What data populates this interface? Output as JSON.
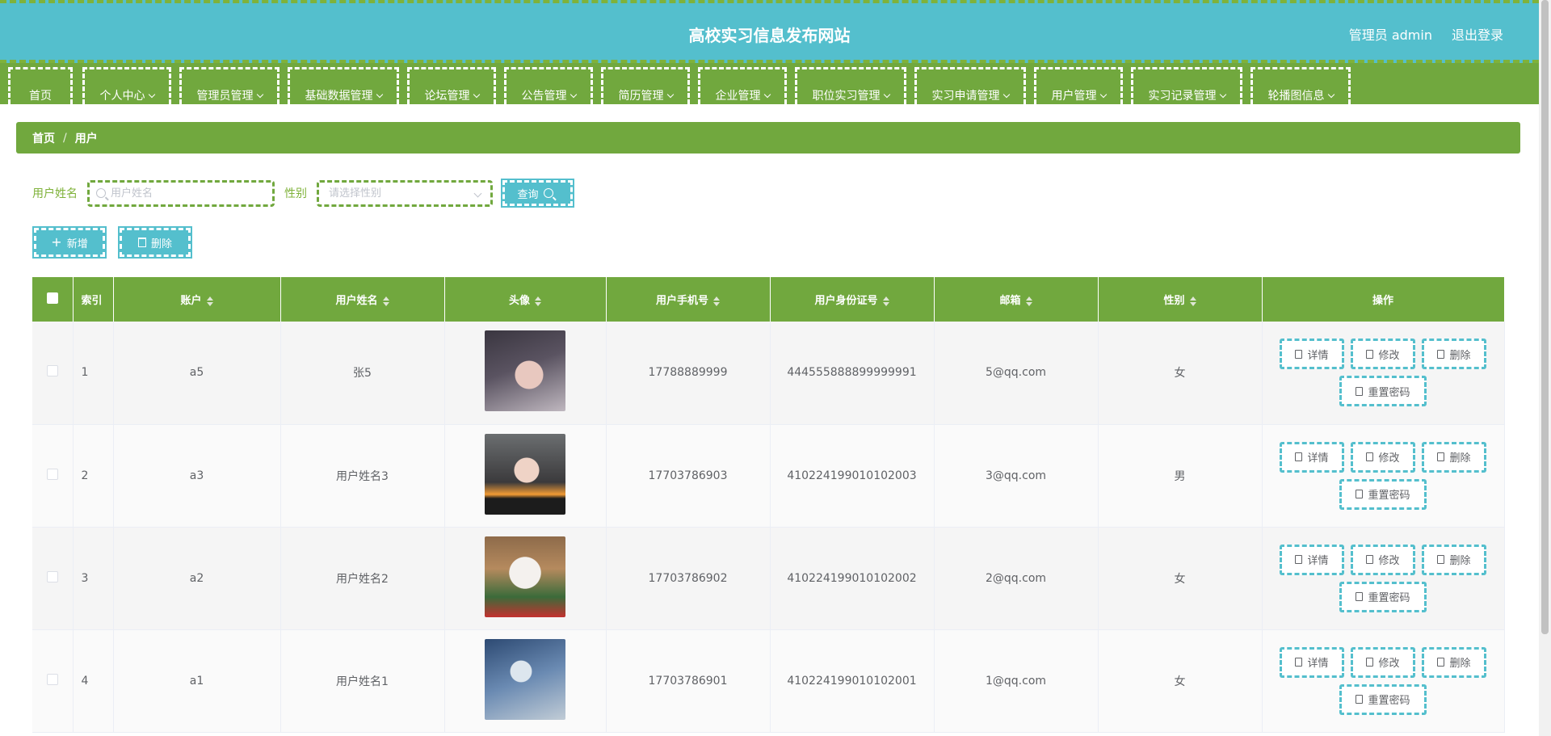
{
  "header": {
    "title": "高校实习信息发布网站",
    "user_label": "管理员 admin",
    "logout_label": "退出登录"
  },
  "nav": {
    "items": [
      {
        "label": "首页",
        "has_dropdown": false
      },
      {
        "label": "个人中心",
        "has_dropdown": true
      },
      {
        "label": "管理员管理",
        "has_dropdown": true
      },
      {
        "label": "基础数据管理",
        "has_dropdown": true
      },
      {
        "label": "论坛管理",
        "has_dropdown": true
      },
      {
        "label": "公告管理",
        "has_dropdown": true
      },
      {
        "label": "简历管理",
        "has_dropdown": true
      },
      {
        "label": "企业管理",
        "has_dropdown": true
      },
      {
        "label": "职位实习管理",
        "has_dropdown": true
      },
      {
        "label": "实习申请管理",
        "has_dropdown": true
      },
      {
        "label": "用户管理",
        "has_dropdown": true
      },
      {
        "label": "实习记录管理",
        "has_dropdown": true
      },
      {
        "label": "轮播图信息",
        "has_dropdown": true
      }
    ]
  },
  "breadcrumb": {
    "home": "首页",
    "separator": "/",
    "current": "用户"
  },
  "search": {
    "name_label": "用户姓名",
    "name_placeholder": "用户姓名",
    "gender_label": "性别",
    "gender_placeholder": "请选择性别",
    "query_label": "查询"
  },
  "actions": {
    "add_label": "新增",
    "delete_label": "删除"
  },
  "table": {
    "columns": [
      "索引",
      "账户",
      "用户姓名",
      "头像",
      "用户手机号",
      "用户身份证号",
      "邮箱",
      "性别",
      "操作"
    ],
    "rows": [
      {
        "index": "1",
        "account": "a5",
        "name": "张5",
        "avatar": "avatar-photo-1",
        "phone": "17788889999",
        "id_card": "444555888899999991",
        "email": "5@qq.com",
        "gender": "女"
      },
      {
        "index": "2",
        "account": "a3",
        "name": "用户姓名3",
        "avatar": "avatar-photo-2",
        "phone": "17703786903",
        "id_card": "410224199010102003",
        "email": "3@qq.com",
        "gender": "男"
      },
      {
        "index": "3",
        "account": "a2",
        "name": "用户姓名2",
        "avatar": "avatar-photo-3",
        "phone": "17703786902",
        "id_card": "410224199010102002",
        "email": "2@qq.com",
        "gender": "女"
      },
      {
        "index": "4",
        "account": "a1",
        "name": "用户姓名1",
        "avatar": "avatar-photo-4",
        "phone": "17703786901",
        "id_card": "410224199010102001",
        "email": "1@qq.com",
        "gender": "女"
      }
    ],
    "op_labels": {
      "detail": "详情",
      "edit": "修改",
      "delete": "删除",
      "reset_password": "重置密码"
    }
  },
  "colors": {
    "header_bg": "#54bfcd",
    "nav_bg": "#71a83e",
    "accent_green": "#7fb23a",
    "button_blue": "#54bfcd"
  }
}
